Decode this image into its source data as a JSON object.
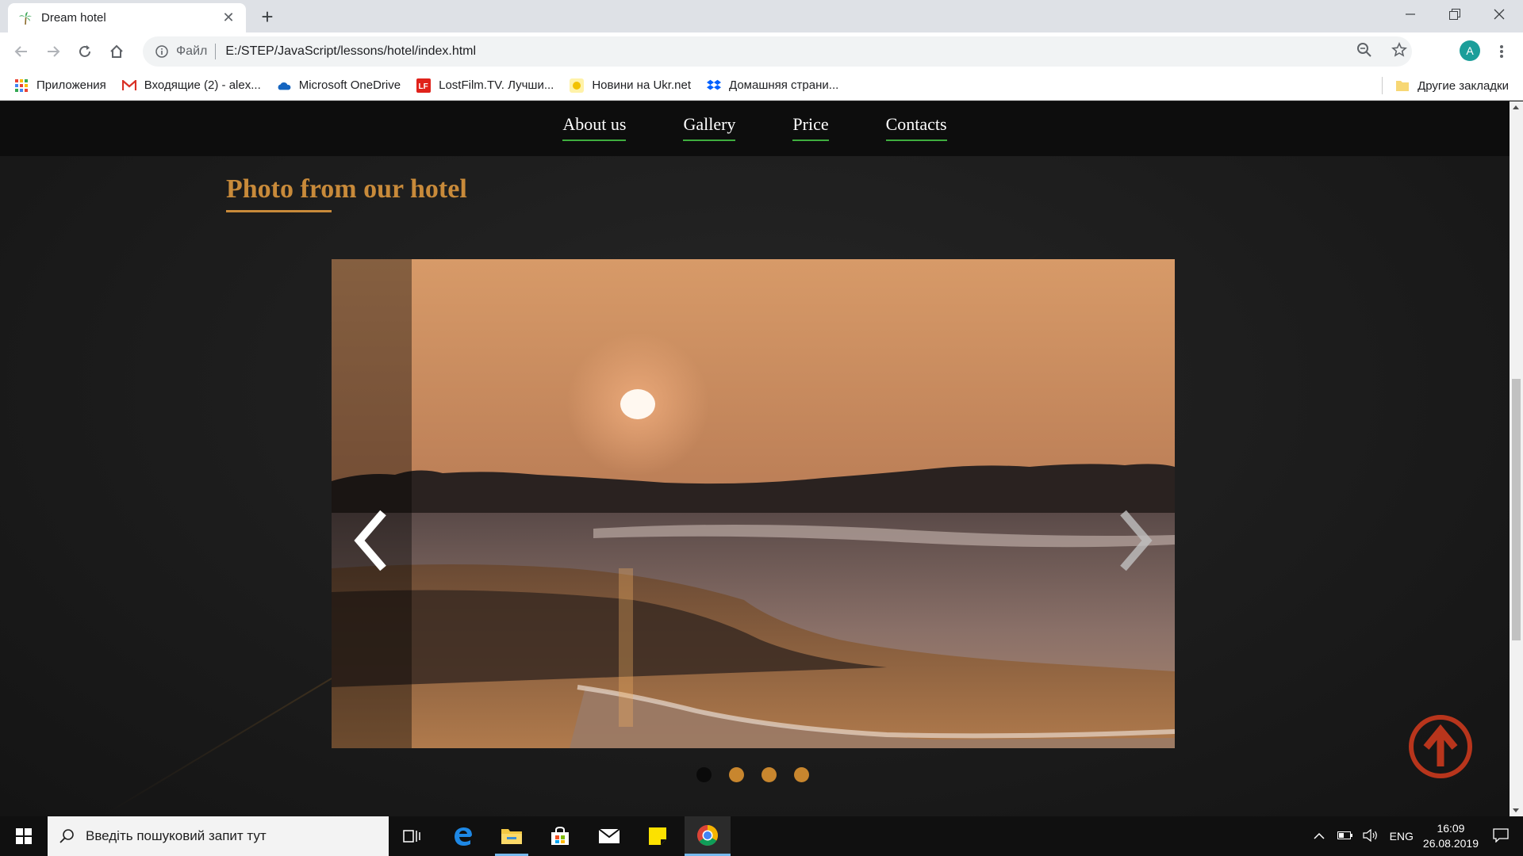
{
  "browser": {
    "tab_title": "Dream hotel",
    "scheme_label": "Файл",
    "url": "E:/STEP/JavaScript/lessons/hotel/index.html",
    "avatar_letter": "A",
    "bookmarks": [
      {
        "label": "Приложения",
        "icon": "apps-grid-icon"
      },
      {
        "label": "Входящие (2) - alex...",
        "icon": "gmail-icon"
      },
      {
        "label": "Microsoft OneDrive",
        "icon": "onedrive-icon"
      },
      {
        "label": "LostFilm.TV. Лучши...",
        "icon": "lostfilm-icon"
      },
      {
        "label": "Новини на Ukr.net",
        "icon": "ukrnet-icon"
      },
      {
        "label": "Домашняя страни...",
        "icon": "dropbox-icon"
      }
    ],
    "other_bookmarks": "Другие закладки"
  },
  "site": {
    "nav": [
      "About us",
      "Gallery",
      "Price",
      "Contacts"
    ],
    "section_title": "Photo from our hotel",
    "slider": {
      "slide_count": 4,
      "active_index": 0
    },
    "colors": {
      "accent": "#c88a3a",
      "nav_underline": "#3fae3f",
      "to_top": "#c0361d"
    }
  },
  "taskbar": {
    "search_placeholder": "Введіть пошуковий запит тут",
    "language": "ENG",
    "time": "16:09",
    "date": "26.08.2019"
  }
}
